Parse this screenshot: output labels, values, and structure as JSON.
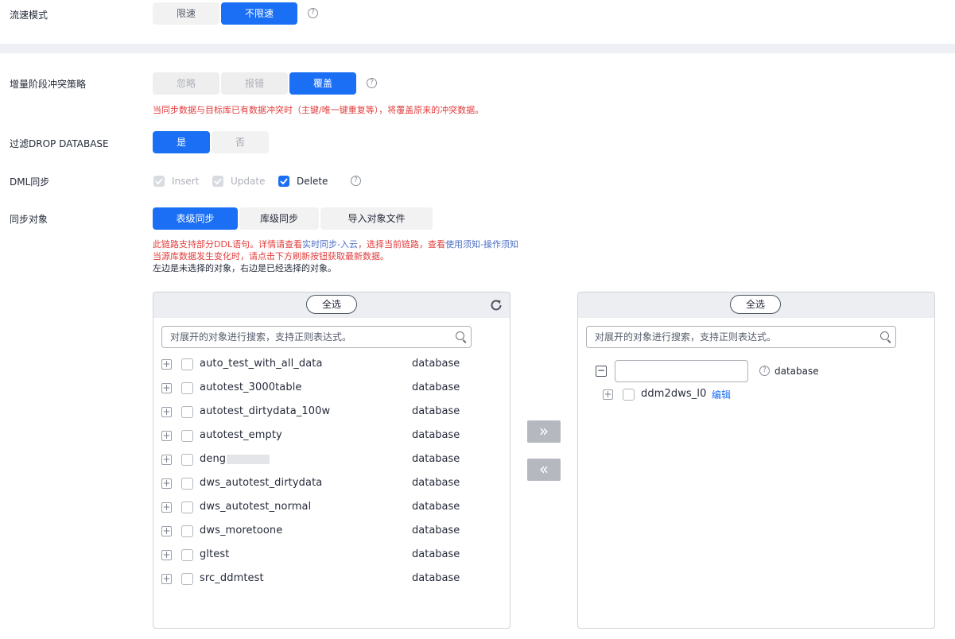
{
  "flow_mode": {
    "label": "流速模式",
    "options": [
      "限速",
      "不限速"
    ],
    "selected": "不限速"
  },
  "conflict_strategy": {
    "label": "增量阶段冲突策略",
    "options": [
      "忽略",
      "报错",
      "覆盖"
    ],
    "selected": "覆盖",
    "note": "当同步数据与目标库已有数据冲突时（主键/唯一键重复等），将覆盖原来的冲突数据。"
  },
  "filter_drop": {
    "label": "过滤DROP DATABASE",
    "options": [
      "是",
      "否"
    ],
    "selected": "是"
  },
  "dml_sync": {
    "label": "DML同步",
    "options": [
      {
        "label": "Insert",
        "checked": true,
        "disabled": true
      },
      {
        "label": "Update",
        "checked": true,
        "disabled": true
      },
      {
        "label": "Delete",
        "checked": true,
        "disabled": false
      }
    ]
  },
  "sync_object": {
    "label": "同步对象",
    "tabs": [
      "表级同步",
      "库级同步",
      "导入对象文件"
    ],
    "selected": "表级同步",
    "notice_prefix": "此链路支持部分DDL语句。详情请查看",
    "notice_link1": "实时同步-入云",
    "notice_mid": "，选择当前链路，查看",
    "notice_link2": "使用须知-操作须知",
    "notice_line2": "当源库数据发生变化时，请点击下方刷新按钮获取最新数据。",
    "notice_line3": "左边是未选择的对象，右边是已经选择的对象。"
  },
  "left_panel": {
    "select_all": "全选",
    "search_placeholder": "对展开的对象进行搜索，支持正则表达式。",
    "items": [
      {
        "name": "auto_test_with_all_data",
        "type": "database"
      },
      {
        "name": "autotest_3000table",
        "type": "database"
      },
      {
        "name": "autotest_dirtydata_100w",
        "type": "database"
      },
      {
        "name": "autotest_empty",
        "type": "database"
      },
      {
        "name": "deng",
        "type": "database"
      },
      {
        "name": "dws_autotest_dirtydata",
        "type": "database"
      },
      {
        "name": "dws_autotest_normal",
        "type": "database"
      },
      {
        "name": "dws_moretoone",
        "type": "database"
      },
      {
        "name": "gltest",
        "type": "database"
      },
      {
        "name": "src_ddmtest",
        "type": "database"
      }
    ]
  },
  "transfer": {
    "add": "»",
    "remove": "«"
  },
  "right_panel": {
    "select_all": "全选",
    "search_placeholder": "对展开的对象进行搜索，支持正则表达式。",
    "group_input_value": "",
    "group_type": "database",
    "items": [
      {
        "name": "ddm2dws_l0",
        "action": "编辑"
      }
    ]
  }
}
